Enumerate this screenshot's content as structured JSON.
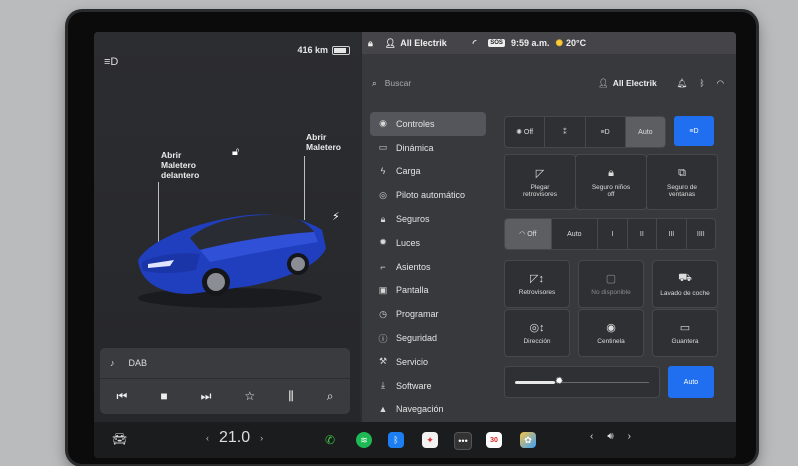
{
  "status": {
    "range": "416 km",
    "profile": "All Electrik",
    "time": "9:59 a.m.",
    "temperature": "20°C",
    "sos": "SOS"
  },
  "car_view": {
    "frunk_label_l1": "Abrir",
    "frunk_label_l2": "Maletero",
    "frunk_label_l3": "delantero",
    "trunk_label_l1": "Abrir",
    "trunk_label_l2": "Maletero",
    "car_color": "#1f3fbf"
  },
  "media": {
    "source": "DAB"
  },
  "search": {
    "placeholder": "Buscar",
    "profile": "All Electrik"
  },
  "nav": {
    "items": [
      {
        "label": "Controles",
        "icon": "toggle-icon"
      },
      {
        "label": "Dinámica",
        "icon": "car-icon"
      },
      {
        "label": "Carga",
        "icon": "bolt-icon"
      },
      {
        "label": "Piloto automático",
        "icon": "steering-icon"
      },
      {
        "label": "Seguros",
        "icon": "lock-icon"
      },
      {
        "label": "Luces",
        "icon": "sun-icon"
      },
      {
        "label": "Asientos",
        "icon": "seat-icon"
      },
      {
        "label": "Pantalla",
        "icon": "display-icon"
      },
      {
        "label": "Programar",
        "icon": "clock-icon"
      },
      {
        "label": "Seguridad",
        "icon": "info-icon"
      },
      {
        "label": "Servicio",
        "icon": "wrench-icon"
      },
      {
        "label": "Software",
        "icon": "download-icon"
      },
      {
        "label": "Navegación",
        "icon": "navigation-icon"
      }
    ]
  },
  "controls": {
    "lights": {
      "off": "Off",
      "auto": "Auto"
    },
    "tiles_row1": [
      {
        "label_l1": "Plegar",
        "label_l2": "retrovisores"
      },
      {
        "label_l1": "Seguro niños",
        "label_l2": "off"
      },
      {
        "label_l1": "Seguro de",
        "label_l2": "ventanas"
      }
    ],
    "wipers": {
      "off": "Off",
      "auto": "Auto",
      "s1": "I",
      "s2": "II",
      "s3": "III",
      "s4": "IIII"
    },
    "tiles_row2": [
      {
        "label": "Retrovisores"
      },
      {
        "label": "No disponible"
      },
      {
        "label": "Lavado de coche"
      }
    ],
    "tiles_row3": [
      {
        "label": "Dirección"
      },
      {
        "label": "Centinela"
      },
      {
        "label": "Guantera"
      }
    ],
    "brightness": {
      "auto": "Auto",
      "level": 0.3
    }
  },
  "dock": {
    "temperature": "21.0",
    "calendar_day": "30"
  }
}
